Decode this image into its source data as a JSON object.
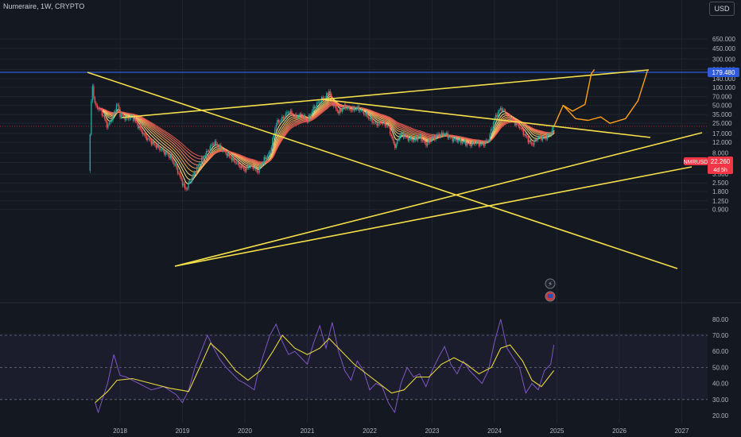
{
  "header": {
    "title": "Numeraire, 1W, CRYPTO"
  },
  "currency_button": "USD",
  "price_axis": {
    "ticks": [
      "650.000",
      "450.000",
      "300.000",
      "200.000",
      "140.000",
      "100.000",
      "70.000",
      "50.000",
      "35.000",
      "25.000",
      "17.000",
      "12.000",
      "8.000",
      "5.500",
      "3.500",
      "2.500",
      "1.800",
      "1.250",
      "0.900"
    ],
    "resistance_label": "179.480",
    "symbol_label": "NMRUSD",
    "price_label": "22.260",
    "countdown_label": "4d 5h"
  },
  "rsi_axis": {
    "ticks": [
      "80.00",
      "70.00",
      "60.00",
      "50.00",
      "40.00",
      "30.00",
      "20.00"
    ]
  },
  "time_axis": {
    "ticks": [
      "2018",
      "2019",
      "2020",
      "2021",
      "2022",
      "2023",
      "2024",
      "2025",
      "2026",
      "2027"
    ]
  },
  "colors": {
    "background": "#141821",
    "trendline": "#f5e04a",
    "resistance": "#2f5bd8",
    "price_marker": "#f23645",
    "rsi": "#7e57c2",
    "rsi_ma": "#e6d83c",
    "up": "#26a69a",
    "down": "#ef5350"
  },
  "chart_data": [
    {
      "type": "candlestick",
      "title": "Numeraire, 1W, CRYPTO",
      "y_scale": "log",
      "ylim": [
        0.8,
        800
      ],
      "xlim": [
        2017.2,
        2027.3
      ],
      "last_price": 22.26,
      "horizontal_level": 179.48,
      "price_path": [
        [
          2017.5,
          4.0
        ],
        [
          2017.55,
          120
        ],
        [
          2017.6,
          50
        ],
        [
          2017.7,
          40
        ],
        [
          2017.8,
          22
        ],
        [
          2017.9,
          35
        ],
        [
          2017.95,
          55
        ],
        [
          2018.0,
          35
        ],
        [
          2018.1,
          30
        ],
        [
          2018.2,
          32
        ],
        [
          2018.4,
          15
        ],
        [
          2018.6,
          10
        ],
        [
          2018.8,
          7
        ],
        [
          2018.9,
          4.5
        ],
        [
          2019.0,
          2.5
        ],
        [
          2019.05,
          1.9
        ],
        [
          2019.1,
          2.4
        ],
        [
          2019.3,
          6
        ],
        [
          2019.4,
          8.5
        ],
        [
          2019.5,
          12
        ],
        [
          2019.6,
          10
        ],
        [
          2019.75,
          7
        ],
        [
          2019.9,
          5
        ],
        [
          2020.0,
          4.2
        ],
        [
          2020.1,
          5
        ],
        [
          2020.2,
          3.8
        ],
        [
          2020.3,
          6
        ],
        [
          2020.4,
          8
        ],
        [
          2020.5,
          25
        ],
        [
          2020.6,
          30
        ],
        [
          2020.7,
          40
        ],
        [
          2020.8,
          32
        ],
        [
          2020.9,
          35
        ],
        [
          2021.0,
          28
        ],
        [
          2021.1,
          45
        ],
        [
          2021.2,
          60
        ],
        [
          2021.3,
          70
        ],
        [
          2021.35,
          90
        ],
        [
          2021.4,
          55
        ],
        [
          2021.5,
          38
        ],
        [
          2021.6,
          48
        ],
        [
          2021.7,
          42
        ],
        [
          2021.8,
          45
        ],
        [
          2021.9,
          38
        ],
        [
          2022.0,
          30
        ],
        [
          2022.1,
          24
        ],
        [
          2022.2,
          26
        ],
        [
          2022.3,
          22
        ],
        [
          2022.4,
          10
        ],
        [
          2022.5,
          17
        ],
        [
          2022.6,
          14
        ],
        [
          2022.7,
          13
        ],
        [
          2022.8,
          15
        ],
        [
          2022.9,
          11
        ],
        [
          2023.0,
          14
        ],
        [
          2023.1,
          16
        ],
        [
          2023.2,
          17
        ],
        [
          2023.3,
          14
        ],
        [
          2023.4,
          13
        ],
        [
          2023.5,
          12
        ],
        [
          2023.6,
          11
        ],
        [
          2023.7,
          12
        ],
        [
          2023.8,
          11
        ],
        [
          2023.9,
          13
        ],
        [
          2024.0,
          30
        ],
        [
          2024.1,
          45
        ],
        [
          2024.2,
          35
        ],
        [
          2024.3,
          27
        ],
        [
          2024.4,
          22
        ],
        [
          2024.5,
          15
        ],
        [
          2024.6,
          11
        ],
        [
          2024.7,
          15
        ],
        [
          2024.8,
          14
        ],
        [
          2024.9,
          17
        ],
        [
          2024.95,
          22.26
        ]
      ],
      "projection_path": [
        [
          2024.95,
          22
        ],
        [
          2025.1,
          50
        ],
        [
          2025.25,
          40
        ],
        [
          2025.45,
          52
        ],
        [
          2025.55,
          170
        ],
        [
          2025.6,
          200
        ]
      ],
      "projection_path_2": [
        [
          2025.1,
          50
        ],
        [
          2025.3,
          30
        ],
        [
          2025.5,
          28
        ],
        [
          2025.7,
          32
        ],
        [
          2025.85,
          25
        ],
        [
          2026.1,
          30
        ],
        [
          2026.3,
          60
        ],
        [
          2026.45,
          190
        ]
      ]
    },
    {
      "type": "line",
      "title": "RSI",
      "ylim": [
        15,
        85
      ],
      "levels": [
        70,
        50,
        30
      ],
      "series": [
        {
          "values": [
            [
              2017.6,
              28
            ],
            [
              2017.65,
              22
            ],
            [
              2017.8,
              40
            ],
            [
              2017.9,
              58
            ],
            [
              2018.0,
              45
            ],
            [
              2018.1,
              44
            ],
            [
              2018.3,
              40
            ],
            [
              2018.5,
              36
            ],
            [
              2018.7,
              38
            ],
            [
              2018.9,
              33
            ],
            [
              2019.0,
              28
            ],
            [
              2019.1,
              36
            ],
            [
              2019.2,
              50
            ],
            [
              2019.3,
              60
            ],
            [
              2019.4,
              70
            ],
            [
              2019.5,
              62
            ],
            [
              2019.6,
              55
            ],
            [
              2019.7,
              50
            ],
            [
              2019.9,
              42
            ],
            [
              2020.0,
              40
            ],
            [
              2020.15,
              36
            ],
            [
              2020.2,
              45
            ],
            [
              2020.3,
              58
            ],
            [
              2020.4,
              70
            ],
            [
              2020.5,
              77
            ],
            [
              2020.6,
              66
            ],
            [
              2020.7,
              58
            ],
            [
              2020.8,
              60
            ],
            [
              2020.9,
              56
            ],
            [
              2021.0,
              52
            ],
            [
              2021.1,
              65
            ],
            [
              2021.2,
              76
            ],
            [
              2021.3,
              62
            ],
            [
              2021.4,
              78
            ],
            [
              2021.5,
              60
            ],
            [
              2021.6,
              48
            ],
            [
              2021.7,
              42
            ],
            [
              2021.8,
              54
            ],
            [
              2021.9,
              48
            ],
            [
              2022.0,
              36
            ],
            [
              2022.1,
              40
            ],
            [
              2022.2,
              38
            ],
            [
              2022.3,
              28
            ],
            [
              2022.4,
              22
            ],
            [
              2022.5,
              40
            ],
            [
              2022.6,
              50
            ],
            [
              2022.7,
              44
            ],
            [
              2022.8,
              46
            ],
            [
              2022.9,
              38
            ],
            [
              2023.0,
              48
            ],
            [
              2023.1,
              56
            ],
            [
              2023.2,
              63
            ],
            [
              2023.3,
              52
            ],
            [
              2023.4,
              46
            ],
            [
              2023.5,
              54
            ],
            [
              2023.6,
              48
            ],
            [
              2023.7,
              44
            ],
            [
              2023.8,
              40
            ],
            [
              2023.9,
              48
            ],
            [
              2024.0,
              66
            ],
            [
              2024.1,
              80
            ],
            [
              2024.2,
              62
            ],
            [
              2024.3,
              56
            ],
            [
              2024.4,
              50
            ],
            [
              2024.5,
              34
            ],
            [
              2024.6,
              40
            ],
            [
              2024.7,
              36
            ],
            [
              2024.8,
              48
            ],
            [
              2024.9,
              52
            ],
            [
              2024.95,
              64
            ]
          ]
        },
        {
          "values": [
            [
              2017.6,
              28
            ],
            [
              2017.8,
              35
            ],
            [
              2017.95,
              42
            ],
            [
              2018.2,
              43
            ],
            [
              2018.5,
              40
            ],
            [
              2018.8,
              37
            ],
            [
              2019.1,
              35
            ],
            [
              2019.3,
              52
            ],
            [
              2019.45,
              65
            ],
            [
              2019.65,
              58
            ],
            [
              2019.85,
              48
            ],
            [
              2020.05,
              42
            ],
            [
              2020.25,
              48
            ],
            [
              2020.45,
              60
            ],
            [
              2020.6,
              70
            ],
            [
              2020.8,
              62
            ],
            [
              2021.0,
              58
            ],
            [
              2021.2,
              62
            ],
            [
              2021.35,
              68
            ],
            [
              2021.55,
              60
            ],
            [
              2021.75,
              52
            ],
            [
              2021.95,
              46
            ],
            [
              2022.15,
              40
            ],
            [
              2022.35,
              34
            ],
            [
              2022.55,
              36
            ],
            [
              2022.75,
              44
            ],
            [
              2022.95,
              44
            ],
            [
              2023.15,
              52
            ],
            [
              2023.35,
              56
            ],
            [
              2023.55,
              52
            ],
            [
              2023.75,
              46
            ],
            [
              2023.95,
              50
            ],
            [
              2024.1,
              62
            ],
            [
              2024.25,
              64
            ],
            [
              2024.45,
              54
            ],
            [
              2024.6,
              42
            ],
            [
              2024.75,
              38
            ],
            [
              2024.95,
              48
            ]
          ]
        }
      ]
    }
  ]
}
